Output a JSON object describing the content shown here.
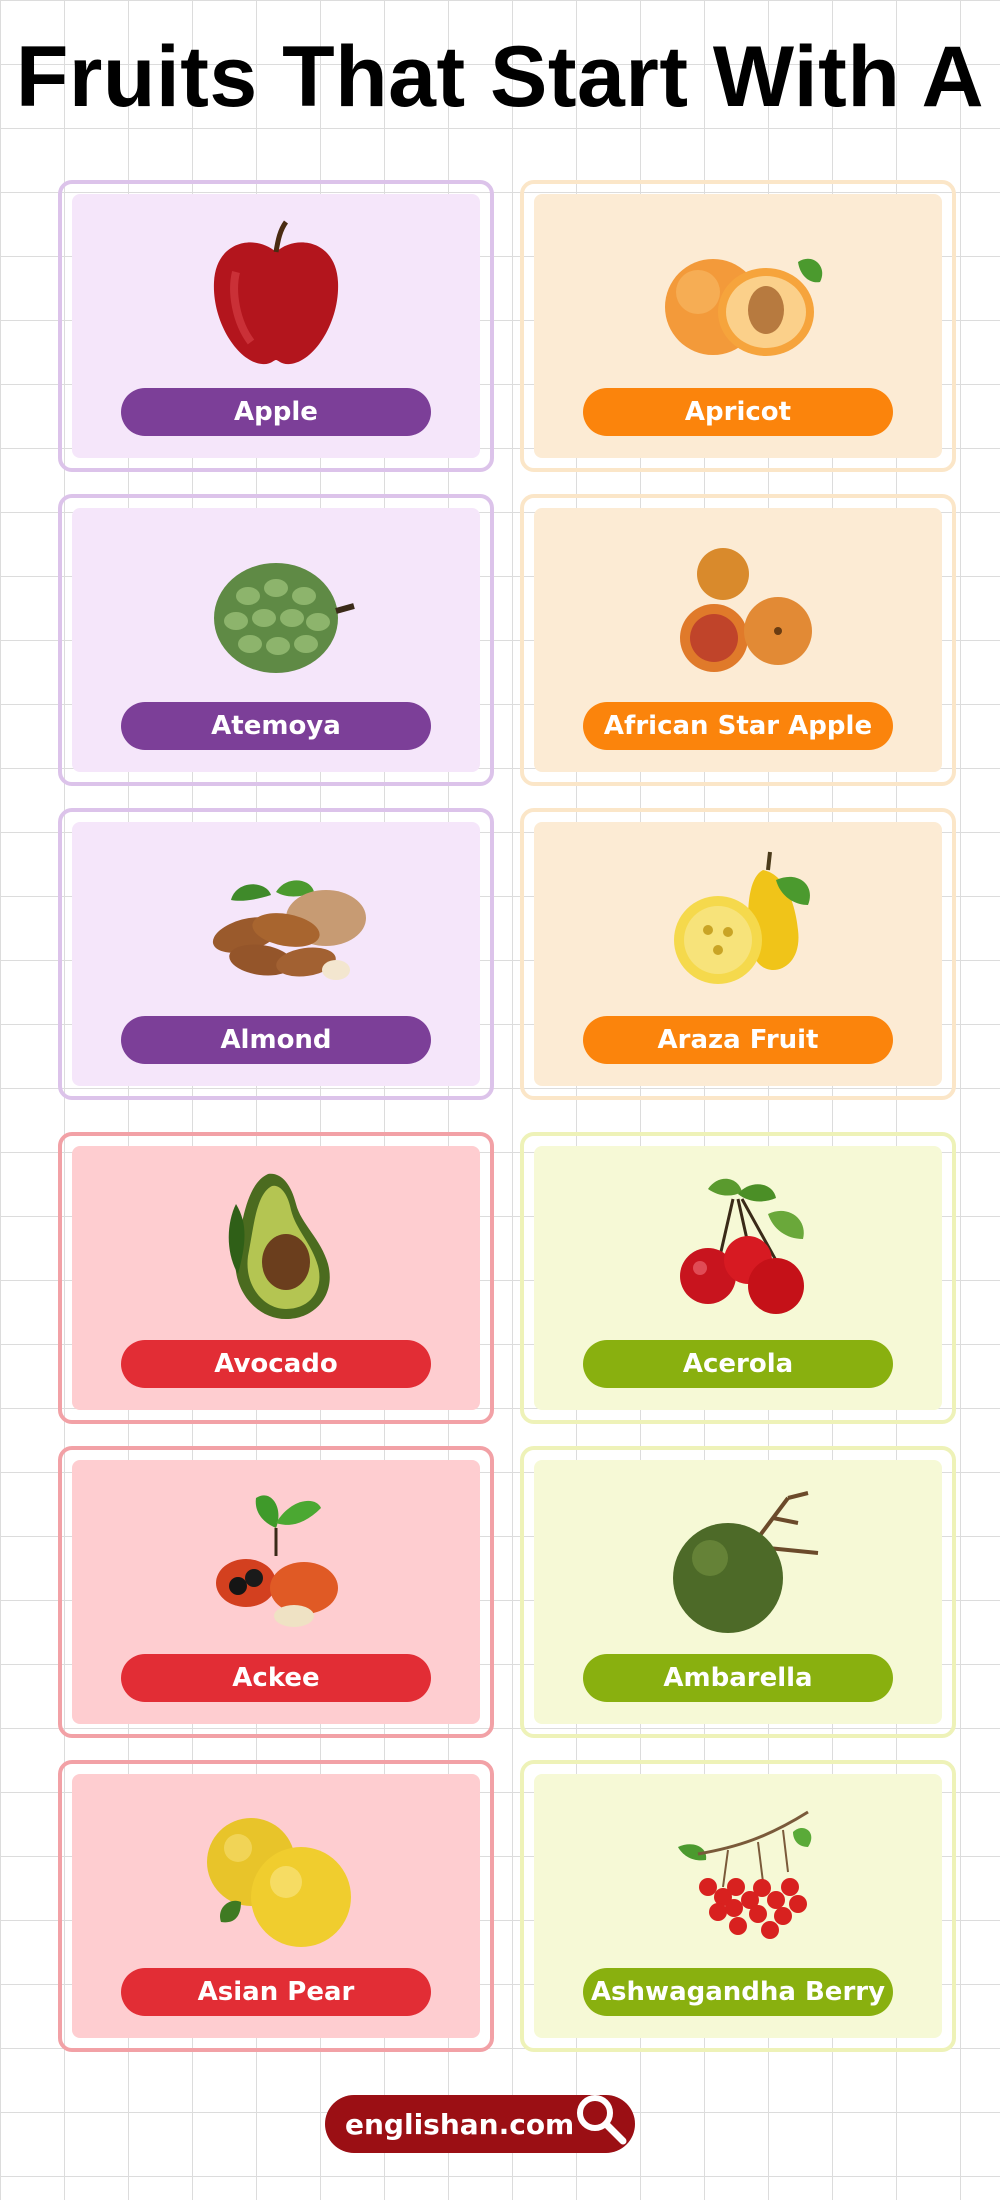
{
  "title": "Fruits That Start With A",
  "cards": [
    {
      "label": "Apple",
      "icon": "apple-image",
      "theme": "purple"
    },
    {
      "label": "Apricot",
      "icon": "apricot-image",
      "theme": "orange"
    },
    {
      "label": "Atemoya",
      "icon": "atemoya-image",
      "theme": "purple"
    },
    {
      "label": "African Star Apple",
      "icon": "african-star-apple-image",
      "theme": "orange"
    },
    {
      "label": "Almond",
      "icon": "almond-image",
      "theme": "purple"
    },
    {
      "label": "Araza Fruit",
      "icon": "araza-fruit-image",
      "theme": "orange"
    },
    {
      "label": "Avocado",
      "icon": "avocado-image",
      "theme": "red"
    },
    {
      "label": "Acerola",
      "icon": "acerola-image",
      "theme": "green"
    },
    {
      "label": "Ackee",
      "icon": "ackee-image",
      "theme": "red"
    },
    {
      "label": "Ambarella",
      "icon": "ambarella-image",
      "theme": "green"
    },
    {
      "label": "Asian Pear",
      "icon": "asian-pear-image",
      "theme": "red"
    },
    {
      "label": "Ashwagandha Berry",
      "icon": "ashwagandha-berry-image",
      "theme": "green"
    }
  ],
  "footer": {
    "site": "englishan.com",
    "icon": "search-icon"
  },
  "colors": {
    "purple": "#7c3f98",
    "orange": "#fb840c",
    "red": "#e22d35",
    "green": "#89b00f",
    "footer": "#9b0f14"
  }
}
